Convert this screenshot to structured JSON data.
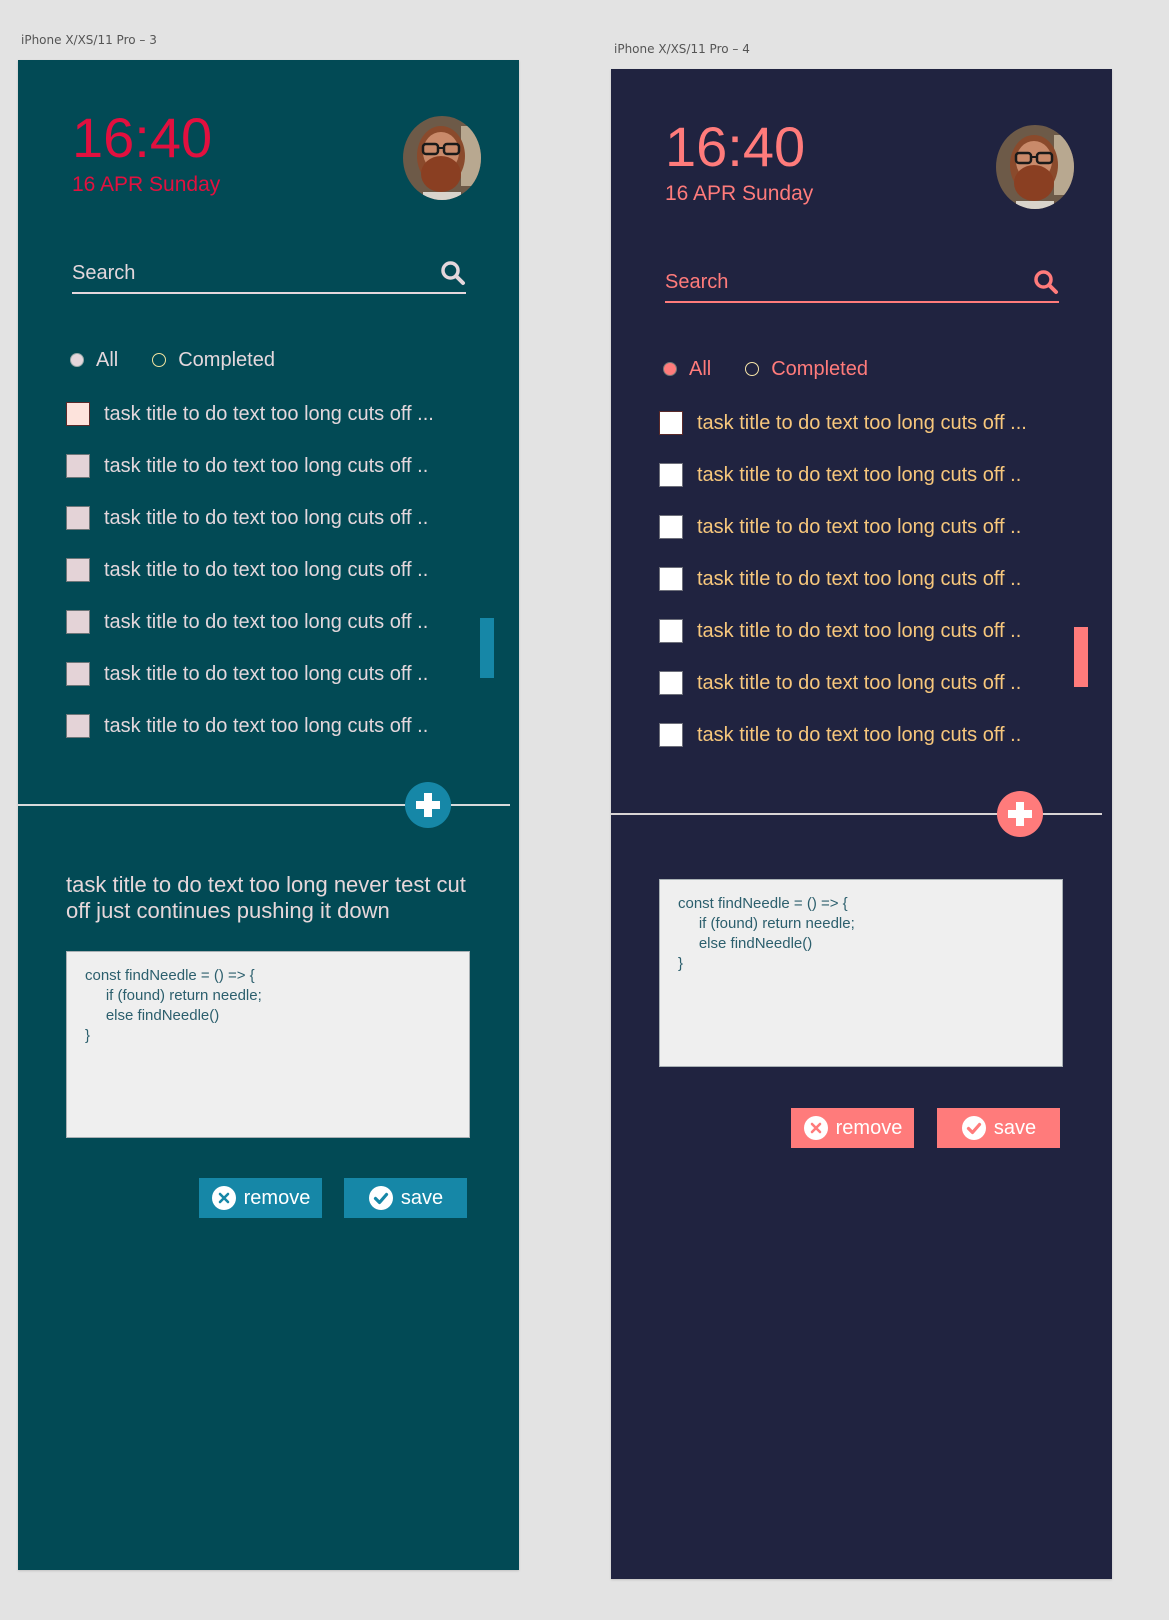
{
  "artboards": [
    {
      "label": "iPhone X/XS/11 Pro – 3",
      "theme": {
        "background": "#024a55",
        "accent": "#1687a7",
        "time_color": "#e2103f",
        "text_color": "#e4d7dc"
      },
      "header": {
        "time": "16:40",
        "date": "16 APR Sunday"
      },
      "search": {
        "placeholder": "Search"
      },
      "filters": [
        {
          "label": "All",
          "selected": true
        },
        {
          "label": "Completed",
          "selected": false
        }
      ],
      "tasks": [
        {
          "title": "task title to do text too long cuts off ...",
          "checked": false
        },
        {
          "title": "task title to do text too long cuts off ..",
          "checked": false
        },
        {
          "title": "task title to do text too long cuts off ..",
          "checked": false
        },
        {
          "title": "task title to do text too long cuts off ..",
          "checked": false
        },
        {
          "title": "task title to do text too long cuts off ..",
          "checked": false
        },
        {
          "title": "task title to do text too long cuts off ..",
          "checked": false
        },
        {
          "title": "task title to do text too long cuts off ..",
          "checked": false
        }
      ],
      "detail": {
        "title": "task title to do text too long never test cut off just continues pushing it down",
        "code": "const findNeedle = () => {\n     if (found) return needle;\n     else findNeedle()\n}"
      },
      "actions": {
        "remove": "remove",
        "save": "save"
      }
    },
    {
      "label": "iPhone X/XS/11 Pro – 4",
      "theme": {
        "background": "#202340",
        "accent": "#ff7b7b",
        "time_color": "#ff7b7b",
        "text_color": "#f7c77c"
      },
      "header": {
        "time": "16:40",
        "date": "16 APR Sunday"
      },
      "search": {
        "placeholder": "Search"
      },
      "filters": [
        {
          "label": "All",
          "selected": true
        },
        {
          "label": "Completed",
          "selected": false
        }
      ],
      "tasks": [
        {
          "title": "task title to do text too long cuts off ...",
          "checked": false
        },
        {
          "title": "task title to do text too long cuts off ..",
          "checked": false
        },
        {
          "title": "task title to do text too long cuts off ..",
          "checked": false
        },
        {
          "title": "task title to do text too long cuts off ..",
          "checked": false
        },
        {
          "title": "task title to do text too long cuts off ..",
          "checked": false
        },
        {
          "title": "task title to do text too long cuts off ..",
          "checked": false
        },
        {
          "title": "task title to do text too long cuts off ..",
          "checked": false
        }
      ],
      "detail": {
        "code": "const findNeedle = () => {\n     if (found) return needle;\n     else findNeedle()\n}"
      },
      "actions": {
        "remove": "remove",
        "save": "save"
      }
    }
  ]
}
